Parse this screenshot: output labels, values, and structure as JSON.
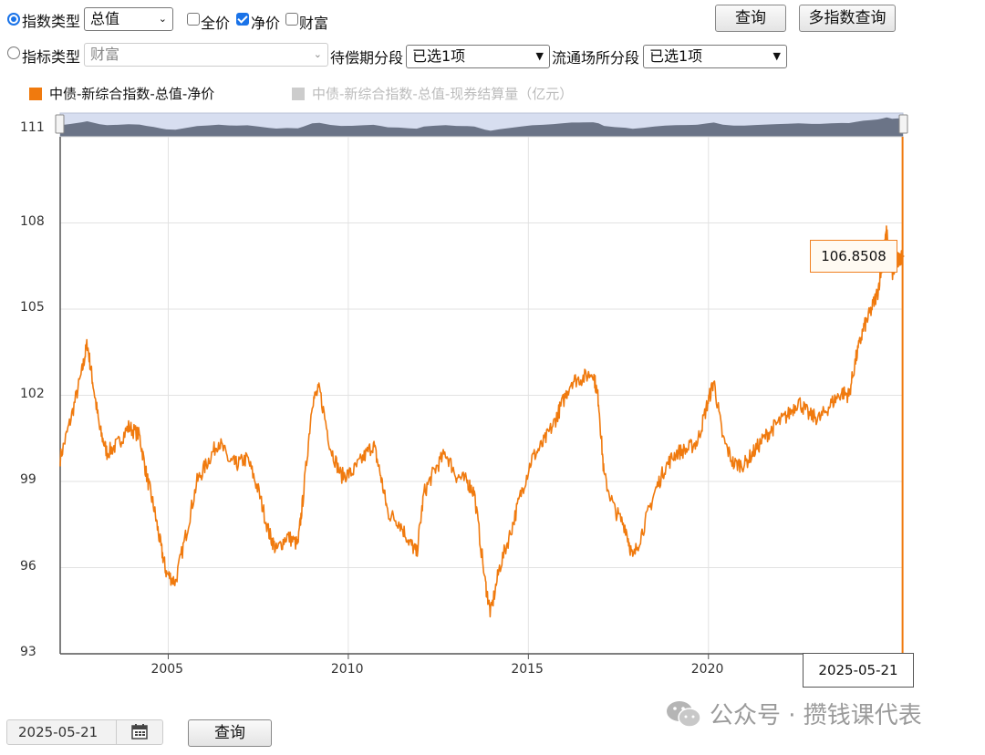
{
  "controls": {
    "index_type_label": "指数类型",
    "index_type_value": "总值",
    "cb_full_price": "全价",
    "cb_net_price": "净价",
    "cb_wealth": "财富",
    "query_label": "查询",
    "multi_query_label": "多指数查询",
    "indicator_type_label": "指标类型",
    "indicator_type_value": "财富",
    "maturity_label": "待偿期分段",
    "maturity_value": "已选1项",
    "venue_label": "流通场所分段",
    "venue_value": "已选1项"
  },
  "legend": {
    "active": "中债-新综合指数-总值-净价",
    "inactive": "中债-新综合指数-总值-现券结算量（亿元）"
  },
  "tooltip": {
    "value": "106.8508",
    "date": "2025-05-21"
  },
  "bottom": {
    "date_value": "2025-05-21",
    "query_label": "查询"
  },
  "watermark": "公众号 · 攒钱课代表",
  "colors": {
    "series": "#f07a0e",
    "active_radio": "#1a73e8",
    "navigator_fill": "#6b7487"
  },
  "chart_data": {
    "type": "line",
    "title": "",
    "xlabel": "",
    "ylabel": "",
    "ylim": [
      93,
      111
    ],
    "yticks": [
      93,
      96,
      99,
      102,
      105,
      108,
      111
    ],
    "xticks": [
      "2005",
      "2010",
      "2015",
      "2020"
    ],
    "xlim": [
      2002.0,
      2025.4
    ],
    "grid": true,
    "legend_position": "top-left",
    "series": [
      {
        "name": "中债-新综合指数-总值-净价",
        "color": "#f07a0e",
        "points": [
          [
            2002.0,
            99.8
          ],
          [
            2002.3,
            101.2
          ],
          [
            2002.6,
            102.8
          ],
          [
            2002.75,
            103.8
          ],
          [
            2002.9,
            102.5
          ],
          [
            2003.1,
            100.8
          ],
          [
            2003.3,
            100.0
          ],
          [
            2003.6,
            100.3
          ],
          [
            2003.9,
            100.9
          ],
          [
            2004.2,
            100.6
          ],
          [
            2004.4,
            99.2
          ],
          [
            2004.6,
            98.1
          ],
          [
            2004.8,
            96.7
          ],
          [
            2004.95,
            95.8
          ],
          [
            2005.2,
            95.5
          ],
          [
            2005.5,
            97.2
          ],
          [
            2005.8,
            99.0
          ],
          [
            2006.1,
            99.7
          ],
          [
            2006.4,
            100.4
          ],
          [
            2006.7,
            99.7
          ],
          [
            2006.9,
            99.6
          ],
          [
            2007.2,
            99.8
          ],
          [
            2007.5,
            98.7
          ],
          [
            2007.8,
            97.2
          ],
          [
            2008.0,
            96.6
          ],
          [
            2008.3,
            97.1
          ],
          [
            2008.6,
            96.8
          ],
          [
            2008.75,
            98.5
          ],
          [
            2009.0,
            101.8
          ],
          [
            2009.2,
            102.2
          ],
          [
            2009.5,
            100.2
          ],
          [
            2009.8,
            99.2
          ],
          [
            2010.1,
            99.3
          ],
          [
            2010.4,
            99.8
          ],
          [
            2010.7,
            100.3
          ],
          [
            2010.9,
            99.2
          ],
          [
            2011.1,
            97.9
          ],
          [
            2011.4,
            97.6
          ],
          [
            2011.7,
            96.9
          ],
          [
            2011.9,
            96.5
          ],
          [
            2012.1,
            98.6
          ],
          [
            2012.4,
            99.4
          ],
          [
            2012.7,
            100.0
          ],
          [
            2013.0,
            99.2
          ],
          [
            2013.3,
            99.0
          ],
          [
            2013.5,
            98.6
          ],
          [
            2013.8,
            95.5
          ],
          [
            2013.95,
            94.4
          ],
          [
            2014.2,
            96.0
          ],
          [
            2014.5,
            97.2
          ],
          [
            2014.8,
            98.6
          ],
          [
            2015.1,
            99.8
          ],
          [
            2015.4,
            100.3
          ],
          [
            2015.7,
            101.0
          ],
          [
            2015.9,
            101.6
          ],
          [
            2016.2,
            102.5
          ],
          [
            2016.5,
            102.6
          ],
          [
            2016.8,
            102.8
          ],
          [
            2016.95,
            101.8
          ],
          [
            2017.1,
            99.2
          ],
          [
            2017.4,
            98.0
          ],
          [
            2017.7,
            97.4
          ],
          [
            2017.9,
            96.3
          ],
          [
            2018.2,
            97.4
          ],
          [
            2018.5,
            98.6
          ],
          [
            2018.8,
            99.5
          ],
          [
            2019.1,
            100.0
          ],
          [
            2019.4,
            100.1
          ],
          [
            2019.7,
            100.4
          ],
          [
            2019.95,
            101.6
          ],
          [
            2020.15,
            102.5
          ],
          [
            2020.4,
            100.5
          ],
          [
            2020.7,
            99.6
          ],
          [
            2021.0,
            99.6
          ],
          [
            2021.3,
            100.1
          ],
          [
            2021.6,
            100.6
          ],
          [
            2021.9,
            101.0
          ],
          [
            2022.2,
            101.3
          ],
          [
            2022.5,
            101.8
          ],
          [
            2022.8,
            101.3
          ],
          [
            2023.1,
            101.2
          ],
          [
            2023.4,
            101.7
          ],
          [
            2023.7,
            102.1
          ],
          [
            2023.9,
            102.0
          ],
          [
            2024.1,
            103.3
          ],
          [
            2024.3,
            104.3
          ],
          [
            2024.5,
            104.9
          ],
          [
            2024.7,
            105.6
          ],
          [
            2024.85,
            106.8
          ],
          [
            2024.95,
            107.7
          ],
          [
            2025.1,
            106.2
          ],
          [
            2025.25,
            106.6
          ],
          [
            2025.39,
            106.85
          ]
        ]
      }
    ]
  }
}
